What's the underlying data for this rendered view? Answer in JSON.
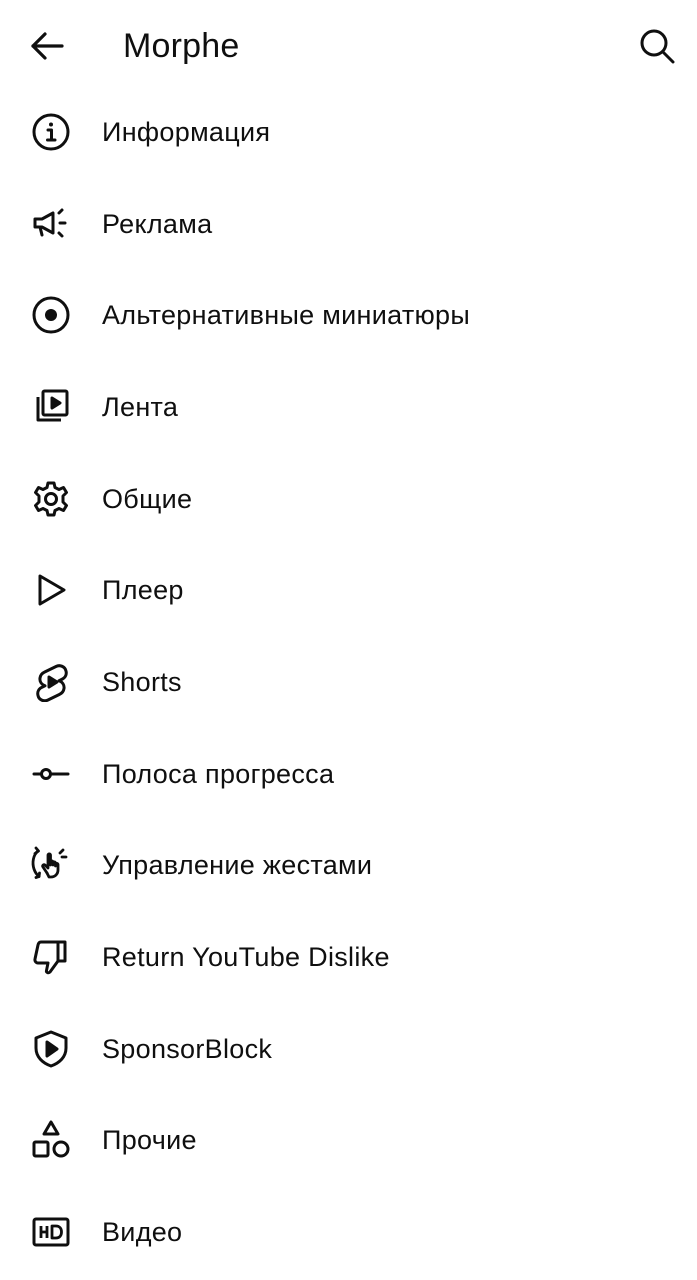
{
  "header": {
    "title": "Morphe",
    "back_icon": "arrow-left-icon",
    "search_icon": "search-icon"
  },
  "menu": {
    "items": [
      {
        "label": "Информация",
        "icon": "info-icon"
      },
      {
        "label": "Реклама",
        "icon": "megaphone-icon"
      },
      {
        "label": "Альтернативные миниатюры",
        "icon": "radio-dot-icon"
      },
      {
        "label": "Лента",
        "icon": "video-library-icon"
      },
      {
        "label": "Общие",
        "icon": "gear-icon"
      },
      {
        "label": "Плеер",
        "icon": "play-icon"
      },
      {
        "label": "Shorts",
        "icon": "shorts-icon"
      },
      {
        "label": "Полоса прогресса",
        "icon": "progress-bar-icon"
      },
      {
        "label": "Управление жестами",
        "icon": "gesture-icon"
      },
      {
        "label": "Return YouTube Dislike",
        "icon": "thumb-down-icon"
      },
      {
        "label": "SponsorBlock",
        "icon": "shield-play-icon"
      },
      {
        "label": "Прочие",
        "icon": "shapes-icon"
      },
      {
        "label": "Видео",
        "icon": "hd-icon"
      }
    ]
  },
  "colors": {
    "text": "#0f0f0f",
    "background": "#ffffff"
  }
}
